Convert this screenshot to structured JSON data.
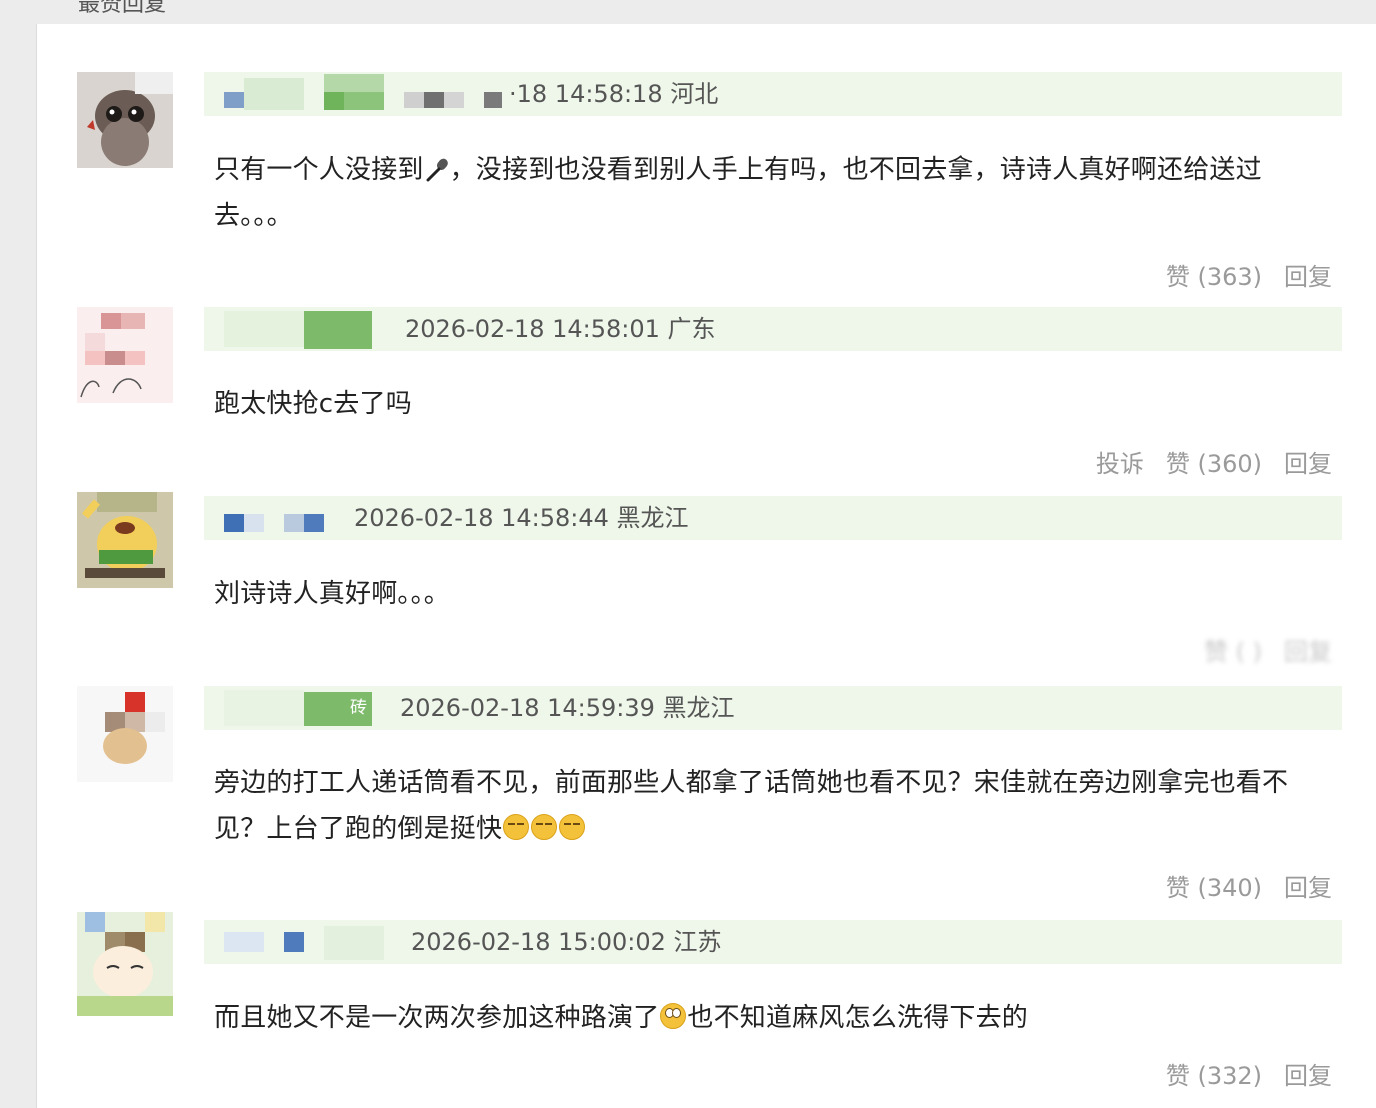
{
  "section": {
    "title": "最赞回复"
  },
  "comments": [
    {
      "meta": "·18 14:58:18 河北",
      "text_before": "只有一个人没接到",
      "text_after": "，没接到也没看到别人手上有吗，也不回去拿，诗诗人真好啊还给送过去。。。",
      "inline_icon": "microphone-emoji",
      "like": "赞 (363)",
      "reply": "回复"
    },
    {
      "meta": "2026-02-18 14:58:01 广东",
      "text": "跑太快抢c去了吗",
      "report": "投诉",
      "like": "赞 (360)",
      "reply": "回复"
    },
    {
      "meta": "2026-02-18 14:58:44 黑龙江",
      "text": "刘诗诗人真好啊。。。",
      "like": "赞 (   )",
      "reply": "回复"
    },
    {
      "meta": "2026-02-18 14:59:39 黑龙江",
      "badge": "砖",
      "text": "旁边的打工人递话筒看不见，前面那些人都拿了话筒她也看不见？宋佳就在旁边刚拿完也看不见？上台了跑的倒是挺快",
      "inline_icon": "expressionless-emoji",
      "like": "赞 (340)",
      "reply": "回复"
    },
    {
      "meta": "2026-02-18 15:00:02 江苏",
      "text_before": "而且她又不是一次两次参加这种路演了",
      "text_after": "也不知道麻风怎么洗得下去的",
      "inline_icon": "rolling-eyes-emoji",
      "like": "赞 (332)",
      "reply": "回复"
    }
  ],
  "colors": {
    "meta_bg": "#eef7ea",
    "action_text": "#9a9a9a",
    "body_text": "#222222"
  }
}
